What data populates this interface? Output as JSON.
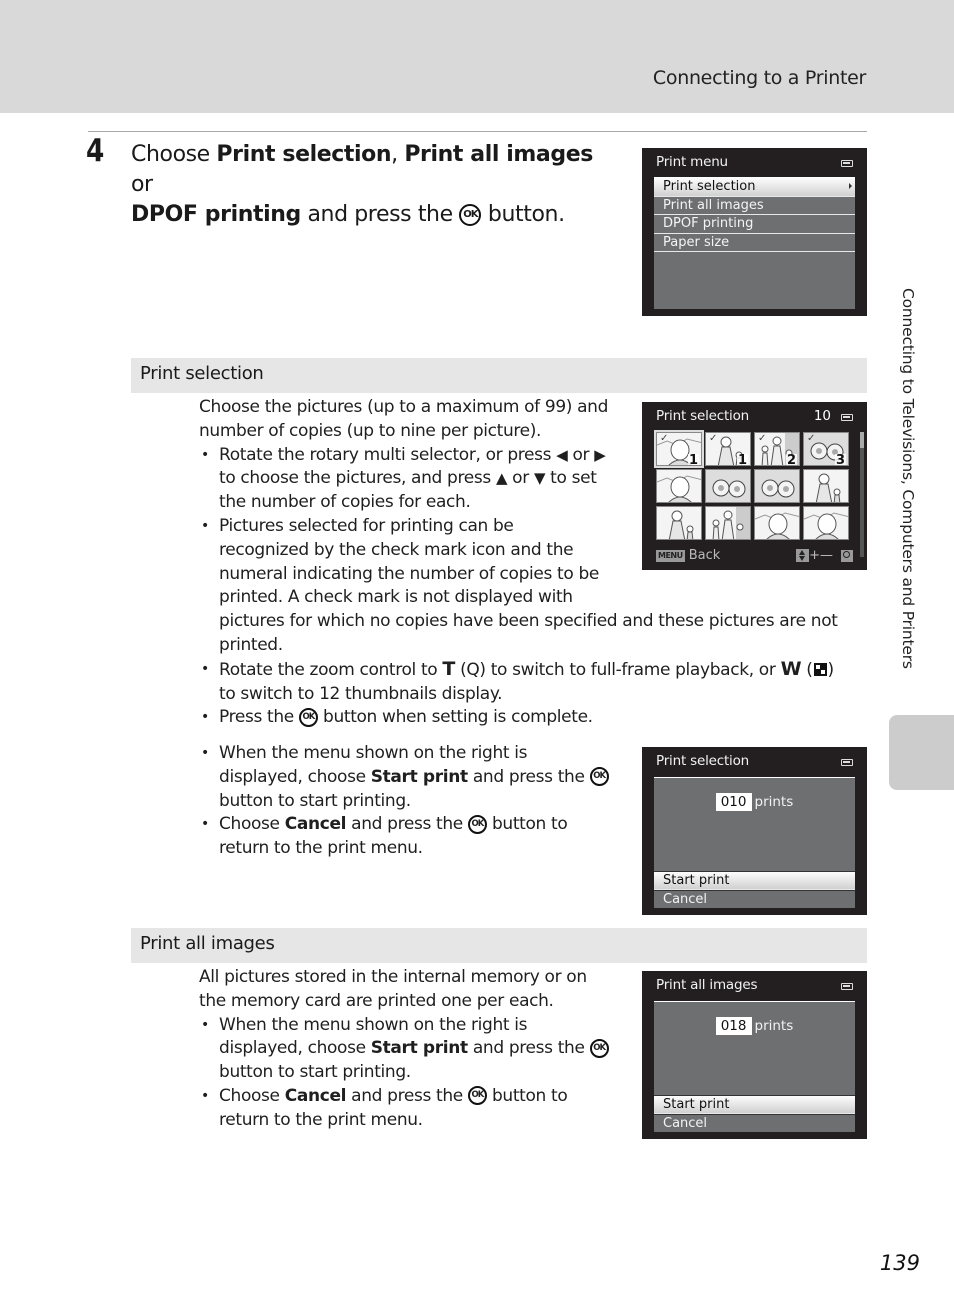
{
  "header": {
    "running_head": "Connecting to a Printer"
  },
  "step": {
    "number": "4",
    "parts": {
      "choose": "Choose ",
      "opt1": "Print selection",
      "comma": ", ",
      "opt2": "Print all images",
      "or": " or",
      "opt3": "DPOF printing",
      "and_press": " and press the ",
      "ok": "OK",
      "button": " button."
    }
  },
  "screens": {
    "print_menu": {
      "title": "Print menu",
      "battery_icon": "battery-icon",
      "items": [
        "Print selection",
        "Print all images",
        "DPOF printing",
        "Paper size"
      ],
      "selected_index": 0
    },
    "print_selection_grid": {
      "title": "Print selection",
      "count": "10",
      "thumbnails": [
        {
          "subject": "portrait",
          "checked": true,
          "copies": "1"
        },
        {
          "subject": "mother-child",
          "checked": true,
          "copies": "1"
        },
        {
          "subject": "family",
          "checked": true,
          "copies": "2"
        },
        {
          "subject": "flowers",
          "checked": true,
          "copies": "3"
        },
        {
          "subject": "portrait",
          "checked": false,
          "copies": ""
        },
        {
          "subject": "flowers",
          "checked": false,
          "copies": ""
        },
        {
          "subject": "flowers",
          "checked": false,
          "copies": ""
        },
        {
          "subject": "mother-child",
          "checked": false,
          "copies": ""
        },
        {
          "subject": "mother-child",
          "checked": false,
          "copies": ""
        },
        {
          "subject": "family",
          "checked": false,
          "copies": ""
        },
        {
          "subject": "portrait",
          "checked": false,
          "copies": ""
        },
        {
          "subject": "portrait",
          "checked": false,
          "copies": ""
        }
      ],
      "menu_key": "MENU",
      "back_label": "Back",
      "plus_minus": "+—"
    },
    "print_selection_confirm": {
      "title": "Print selection",
      "prints_value": "010",
      "prints_label": "prints",
      "items": [
        "Start print",
        "Cancel"
      ],
      "selected_index": 0
    },
    "print_all_confirm": {
      "title": "Print all images",
      "prints_value": "018",
      "prints_label": "prints",
      "items": [
        "Start print",
        "Cancel"
      ],
      "selected_index": 0
    }
  },
  "sections": {
    "print_selection": {
      "heading": "Print selection",
      "intro_1": "Choose the pictures (up to a maximum of 99) and",
      "intro_2": "number of copies (up to nine per picture).",
      "b1_a": "Rotate the rotary multi selector, or press ",
      "b1_left": "◀",
      "b1_or": " or ",
      "b1_right": "▶",
      "b1_b": "to choose the pictures, and press ",
      "b1_up": "▲",
      "b1_or2": " or ",
      "b1_down": "▼",
      "b1_c": " to set",
      "b1_d": "the number of copies for each.",
      "b2_1": "Pictures selected for printing can be",
      "b2_2": "recognized by the check mark icon and the",
      "b2_3": "numeral indicating the number of copies to be",
      "b2_4": "printed. A check mark is not displayed with",
      "b2_5": "pictures for which no copies have been specified and these pictures are not",
      "b2_6": "printed.",
      "b3_a": "Rotate the zoom control to ",
      "b3_T": "T",
      "b3_b": " (",
      "b3_zoom": "Q",
      "b3_c": ") to switch to full-frame playback, or ",
      "b3_W": "W",
      "b3_d": " (",
      "b3_e": ")",
      "b3_f": "to switch to 12 thumbnails display.",
      "b4_a": "Press the ",
      "b4_b": " button when setting is complete.",
      "c1_1": "When the menu shown on the right is",
      "c1_2a": "displayed, choose ",
      "c1_2b": "Start print",
      "c1_2c": " and press the ",
      "c1_3": "button to start printing.",
      "c2_a": "Choose ",
      "c2_b": "Cancel",
      "c2_c": " and press the ",
      "c2_d": " button to",
      "c2_e": "return to the print menu."
    },
    "print_all": {
      "heading": "Print all images",
      "intro_1": "All pictures stored in the internal memory or on",
      "intro_2": "the memory card are printed one per each.",
      "c1_1": "When the menu shown on the right is",
      "c1_2a": "displayed, choose ",
      "c1_2b": "Start print",
      "c1_2c": " and press the ",
      "c1_3": "button to start printing.",
      "c2_a": "Choose ",
      "c2_b": "Cancel",
      "c2_c": " and press the ",
      "c2_d": " button to",
      "c2_e": "return to the print menu."
    }
  },
  "side_tab": {
    "label": "Connecting to Televisions, Computers and Printers"
  },
  "footer": {
    "page_number": "139"
  },
  "ok_label": "OK"
}
